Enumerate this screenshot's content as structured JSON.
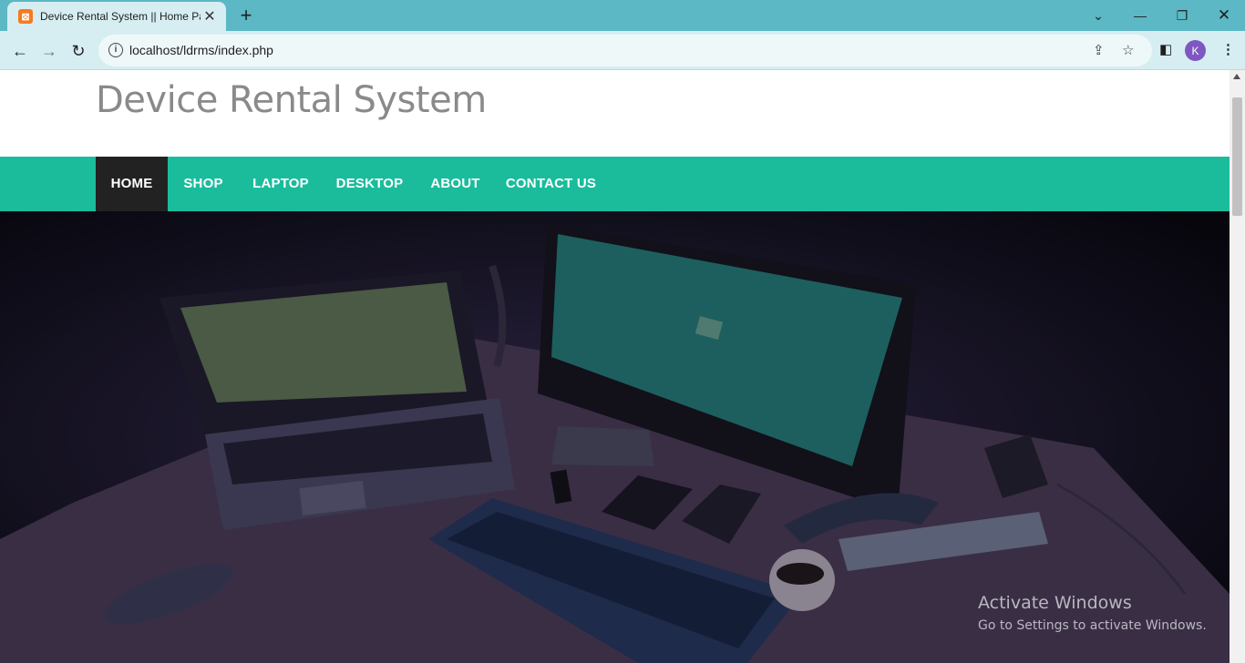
{
  "browser": {
    "tab_title": "Device Rental System || Home Page",
    "url": "localhost/ldrms/index.php",
    "profile_initial": "K"
  },
  "site": {
    "title": "Device Rental System"
  },
  "nav": {
    "items": [
      {
        "label": "HOME",
        "active": true
      },
      {
        "label": "SHOP"
      },
      {
        "label": "LAPTOP"
      },
      {
        "label": "DESKTOP"
      },
      {
        "label": "ABOUT"
      },
      {
        "label": "CONTACT US"
      }
    ]
  },
  "watermark": {
    "title": "Activate Windows",
    "subtitle": "Go to Settings to activate Windows."
  },
  "colors": {
    "nav_bg": "#1abc9c",
    "nav_active": "#222222",
    "chrome": "#5bb8c4"
  }
}
